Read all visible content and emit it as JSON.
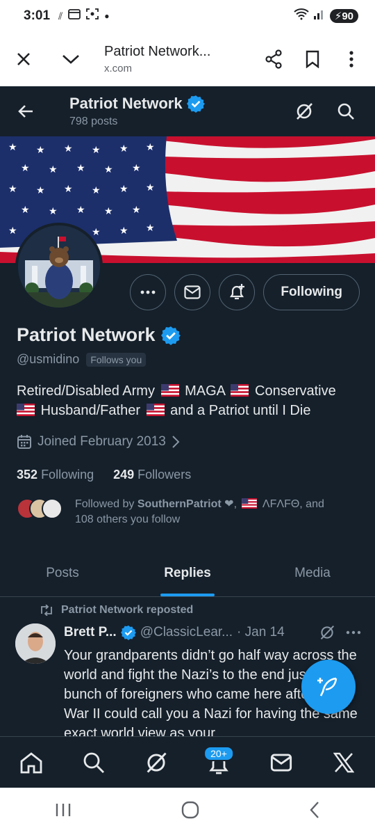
{
  "status_bar": {
    "time": "3:01",
    "battery": "90"
  },
  "browser": {
    "title": "Patriot Network...",
    "url": "x.com"
  },
  "header": {
    "name": "Patriot Network",
    "posts": "798 posts"
  },
  "profile": {
    "name": "Patriot Network",
    "handle": "@usmidino",
    "follows_you": "Follows you",
    "follow_button": "Following",
    "bio_parts": [
      "Retired/Disabled Army",
      "MAGA",
      "Conservative",
      "Husband/Father",
      "and a Patriot until I Die"
    ],
    "joined": "Joined February 2013",
    "following_count": "352",
    "following_label": "Following",
    "followers_count": "249",
    "followers_label": "Followers",
    "followed_by_prefix": "Followed by",
    "followed_by_name": "SouthernPatriot",
    "followed_by_second": "ΛFΛFΘ, and",
    "followed_by_rest": "108 others you follow"
  },
  "tabs": [
    "Posts",
    "Replies",
    "Media"
  ],
  "post": {
    "repost_label": "Patriot Network reposted",
    "author": "Brett P...",
    "handle": "@ClassicLear...",
    "date": "· Jan 14",
    "text": "Your grandparents didn’t go half way across the world and fight the Nazi’s to the end just so a bunch of foreigners who came here after World War II could call you a Nazi for having the same exact world view as your"
  },
  "bottom_nav": {
    "notifications_badge": "20+"
  },
  "colors": {
    "background": "#15202b",
    "accent": "#1d9bf0",
    "muted": "#8b98a5",
    "text": "#e7e9ea"
  }
}
